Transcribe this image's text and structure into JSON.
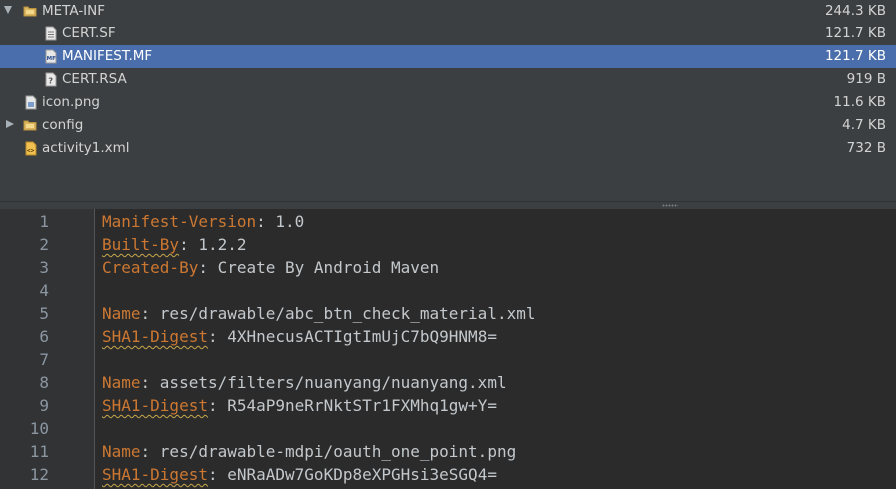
{
  "tree": {
    "items": [
      {
        "name": "META-INF",
        "size": "244.3 KB",
        "type": "folder",
        "expanded": true,
        "depth": 0,
        "selected": false,
        "icon": "folder-icon"
      },
      {
        "name": "CERT.SF",
        "size": "121.7 KB",
        "type": "file",
        "depth": 1,
        "selected": false,
        "icon": "text-file-icon"
      },
      {
        "name": "MANIFEST.MF",
        "size": "121.7 KB",
        "type": "file",
        "depth": 1,
        "selected": true,
        "icon": "manifest-file-icon"
      },
      {
        "name": "CERT.RSA",
        "size": "919 B",
        "type": "file",
        "depth": 1,
        "selected": false,
        "icon": "unknown-file-icon"
      },
      {
        "name": "icon.png",
        "size": "11.6 KB",
        "type": "file",
        "depth": 0,
        "selected": false,
        "icon": "image-file-icon"
      },
      {
        "name": "config",
        "size": "4.7 KB",
        "type": "folder",
        "expanded": false,
        "depth": 0,
        "selected": false,
        "icon": "folder-icon"
      },
      {
        "name": "activity1.xml",
        "size": "732 B",
        "type": "file",
        "depth": 0,
        "selected": false,
        "icon": "xml-file-icon"
      }
    ]
  },
  "editor": {
    "line_numbers": [
      "1",
      "2",
      "3",
      "4",
      "5",
      "6",
      "7",
      "8",
      "9",
      "10",
      "11",
      "12"
    ],
    "lines": [
      {
        "key": "Manifest-Version",
        "sep": ":",
        "value": " 1.0",
        "warn": false
      },
      {
        "key": "Built-By",
        "sep": ":",
        "value": " 1.2.2",
        "warn": true
      },
      {
        "key": "Created-By",
        "sep": ":",
        "value": " Create By Android Maven",
        "warn": false
      },
      {
        "key": "",
        "sep": "",
        "value": "",
        "warn": false
      },
      {
        "key": "Name",
        "sep": ":",
        "value": " res/drawable/abc_btn_check_material.xml",
        "warn": false
      },
      {
        "key": "SHA1-Digest",
        "sep": ":",
        "value": " 4XHnecusACTIgtImUjC7bQ9HNM8=",
        "warn": true
      },
      {
        "key": "",
        "sep": "",
        "value": "",
        "warn": false
      },
      {
        "key": "Name",
        "sep": ":",
        "value": " assets/filters/nuanyang/nuanyang.xml",
        "warn": false
      },
      {
        "key": "SHA1-Digest",
        "sep": ":",
        "value": " R54aP9neRrNktSTr1FXMhq1gw+Y=",
        "warn": true
      },
      {
        "key": "",
        "sep": "",
        "value": "",
        "warn": false
      },
      {
        "key": "Name",
        "sep": ":",
        "value": " res/drawable-mdpi/oauth_one_point.png",
        "warn": false
      },
      {
        "key": "SHA1-Digest",
        "sep": ":",
        "value": " eNRaADw7GoKDp8eXPGHsi3eSGQ4=",
        "warn": true
      }
    ]
  },
  "colors": {
    "tree_bg": "#3c3f41",
    "selection": "#4a6eab",
    "editor_bg": "#2b2b2b",
    "gutter_bg": "#313335",
    "key": "#cc7832",
    "text": "#c3c8cc"
  }
}
